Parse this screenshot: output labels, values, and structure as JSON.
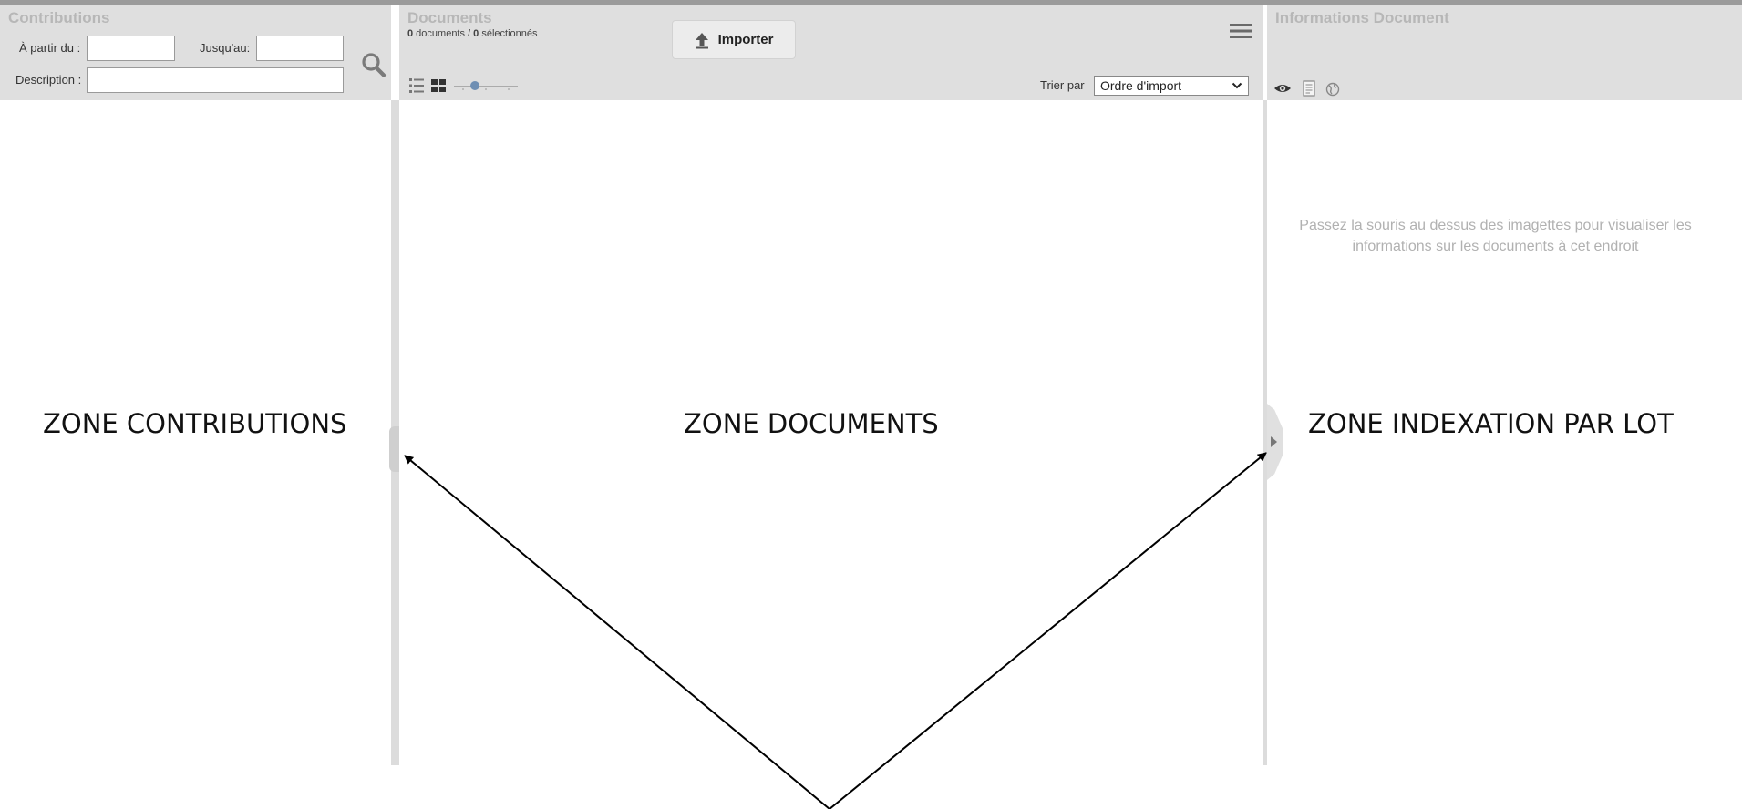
{
  "contributions": {
    "title": "Contributions",
    "from_label": "À partir du :",
    "from_value": "",
    "to_label": "Jusqu'au:",
    "to_value": "",
    "description_label": "Description :",
    "description_value": "",
    "search_icon": "search-icon"
  },
  "documents": {
    "title": "Documents",
    "count_total": "0",
    "count_text": " documents / ",
    "count_selected": "0",
    "selected_text": " sélectionnés",
    "import_label": "Importer",
    "import_icon": "upload-icon",
    "menu_icon": "hamburger-menu-icon",
    "view_icons": [
      "list-view-icon",
      "grid-view-icon"
    ],
    "zoom_level": 0.3,
    "sort_label": "Trier par",
    "sort_value": "Ordre d'import"
  },
  "info": {
    "title": "Informations Document",
    "icons": [
      "eye-icon",
      "document-icon",
      "globe-icon"
    ],
    "hint": "Passez la souris au dessus des imagettes pour visualiser les informations sur les documents à cet endroit"
  },
  "zones": {
    "contributions": "ZONE CONTRIBUTIONS",
    "documents": "ZONE DOCUMENTS",
    "indexation": "ZONE INDEXATION PAR LOT"
  },
  "colors": {
    "header_bg": "#dfdfdf",
    "title_text": "#b7b7b7",
    "splitter": "#dcdcdc"
  }
}
